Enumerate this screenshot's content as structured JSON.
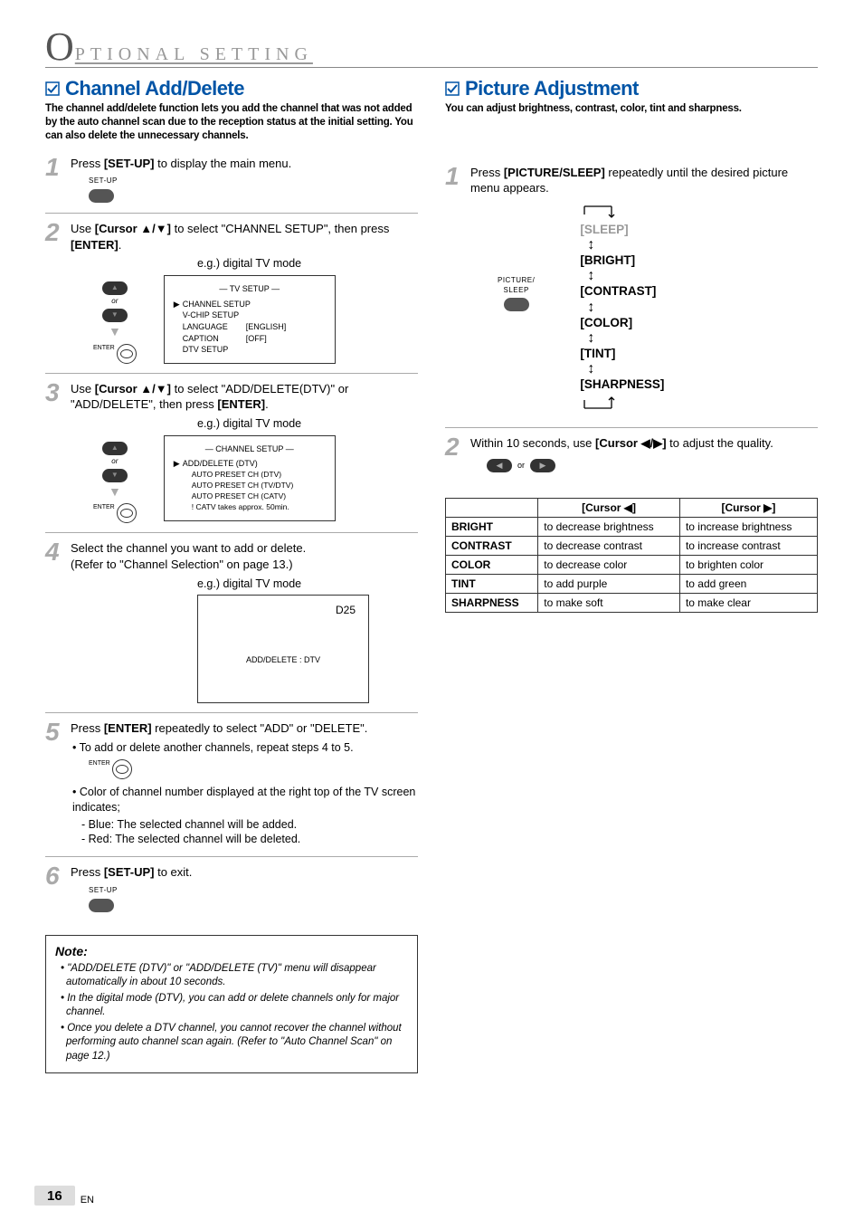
{
  "header": {
    "initial": "O",
    "rest": "PTIONAL  SETTING"
  },
  "left": {
    "title": "Channel Add/Delete",
    "desc": "The channel add/delete function lets you add the channel that was not added by the auto channel scan due to the reception status at the initial setting. You can also delete the unnecessary channels.",
    "eg_label": "e.g.) digital TV mode",
    "steps": {
      "s1": {
        "num": "1",
        "text_a": "Press ",
        "bold1": "[SET-UP]",
        "text_b": " to display the main menu.",
        "remote_label": "SET-UP"
      },
      "s2": {
        "num": "2",
        "text_a": "Use ",
        "bold1": "[Cursor ▲/▼]",
        "text_b": " to select \"CHANNEL SETUP\", then press ",
        "bold2": "[ENTER]",
        "text_c": ".",
        "remote_or": "or",
        "enter_label": "ENTER",
        "tv_title": "—  TV SETUP  —",
        "tv_rows": [
          {
            "tri": "▶",
            "label": "CHANNEL SETUP",
            "val": ""
          },
          {
            "tri": "",
            "label": "V-CHIP  SETUP",
            "val": ""
          },
          {
            "tri": "",
            "label": "LANGUAGE",
            "val": "[ENGLISH]"
          },
          {
            "tri": "",
            "label": "CAPTION",
            "val": "[OFF]"
          },
          {
            "tri": "",
            "label": "DTV SETUP",
            "val": ""
          }
        ]
      },
      "s3": {
        "num": "3",
        "text_a": "Use ",
        "bold1": "[Cursor ▲/▼]",
        "text_b": " to select \"ADD/DELETE(DTV)\" or \"ADD/DELETE\", then press ",
        "bold2": "[ENTER]",
        "text_c": ".",
        "remote_or": "or",
        "enter_label": "ENTER",
        "tv_title": "—  CHANNEL SETUP  —",
        "tv_rows": [
          {
            "tri": "▶",
            "label": "ADD/DELETE (DTV)",
            "val": ""
          },
          {
            "tri": "",
            "label": "AUTO PRESET CH (DTV)",
            "val": ""
          },
          {
            "tri": "",
            "label": "AUTO PRESET CH (TV/DTV)",
            "val": ""
          },
          {
            "tri": "",
            "label": "AUTO PRESET CH (CATV)",
            "val": ""
          },
          {
            "tri": "",
            "label": "! CATV takes approx. 50min.",
            "val": ""
          }
        ]
      },
      "s4": {
        "num": "4",
        "line1": "Select the channel you want to add or delete.",
        "line2": "(Refer to \"Channel Selection\" on page 13.)",
        "d25": "D25",
        "adddel": "ADD/DELETE : DTV"
      },
      "s5": {
        "num": "5",
        "text_a": "Press ",
        "bold1": "[ENTER]",
        "text_b": " repeatedly to select \"ADD\" or \"DELETE\".",
        "bullet1": "• To add or delete another channels, repeat steps 4 to 5.",
        "enter_label": "ENTER",
        "bullet2": "• Color of channel number displayed at the right top of the TV screen indicates;",
        "sub1": "- Blue: The selected channel will be added.",
        "sub2": "- Red: The selected channel will be deleted."
      },
      "s6": {
        "num": "6",
        "text_a": "Press ",
        "bold1": "[SET-UP]",
        "text_b": " to exit.",
        "remote_label": "SET-UP"
      }
    },
    "note": {
      "title": "Note:",
      "items": [
        "• \"ADD/DELETE (DTV)\" or \"ADD/DELETE (TV)\" menu will disappear automatically in about 10 seconds.",
        "• In the digital mode (DTV), you can add or delete channels only for major channel.",
        "• Once you delete a DTV channel, you cannot recover the channel without performing auto channel scan again. (Refer to \"Auto Channel Scan\" on page 12.)"
      ]
    }
  },
  "right": {
    "title": "Picture Adjustment",
    "desc": "You can adjust brightness, contrast, color, tint and sharpness.",
    "steps": {
      "s1": {
        "num": "1",
        "text_a": "Press ",
        "bold1": "[PICTURE/SLEEP]",
        "text_b": " repeatedly until the desired picture menu appears.",
        "remote_label": "PICTURE/\nSLEEP",
        "flow": [
          "[SLEEP]",
          "[BRIGHT]",
          "[CONTRAST]",
          "[COLOR]",
          "[TINT]",
          "[SHARPNESS]"
        ]
      },
      "s2": {
        "num": "2",
        "text_a": "Within 10 seconds, use ",
        "bold1": "[Cursor ◀/▶]",
        "text_b": " to adjust the quality.",
        "or": "or"
      }
    },
    "table": {
      "head_blank": "",
      "head_left": "[Cursor ◀]",
      "head_right": "[Cursor ▶]",
      "rows": [
        {
          "name": "BRIGHT",
          "left": "to decrease brightness",
          "right": "to increase brightness"
        },
        {
          "name": "CONTRAST",
          "left": "to decrease contrast",
          "right": "to increase contrast"
        },
        {
          "name": "COLOR",
          "left": "to decrease color",
          "right": "to brighten color"
        },
        {
          "name": "TINT",
          "left": "to add purple",
          "right": "to add green"
        },
        {
          "name": "SHARPNESS",
          "left": "to make soft",
          "right": "to make clear"
        }
      ]
    }
  },
  "footer": {
    "page": "16",
    "lang": "EN"
  }
}
